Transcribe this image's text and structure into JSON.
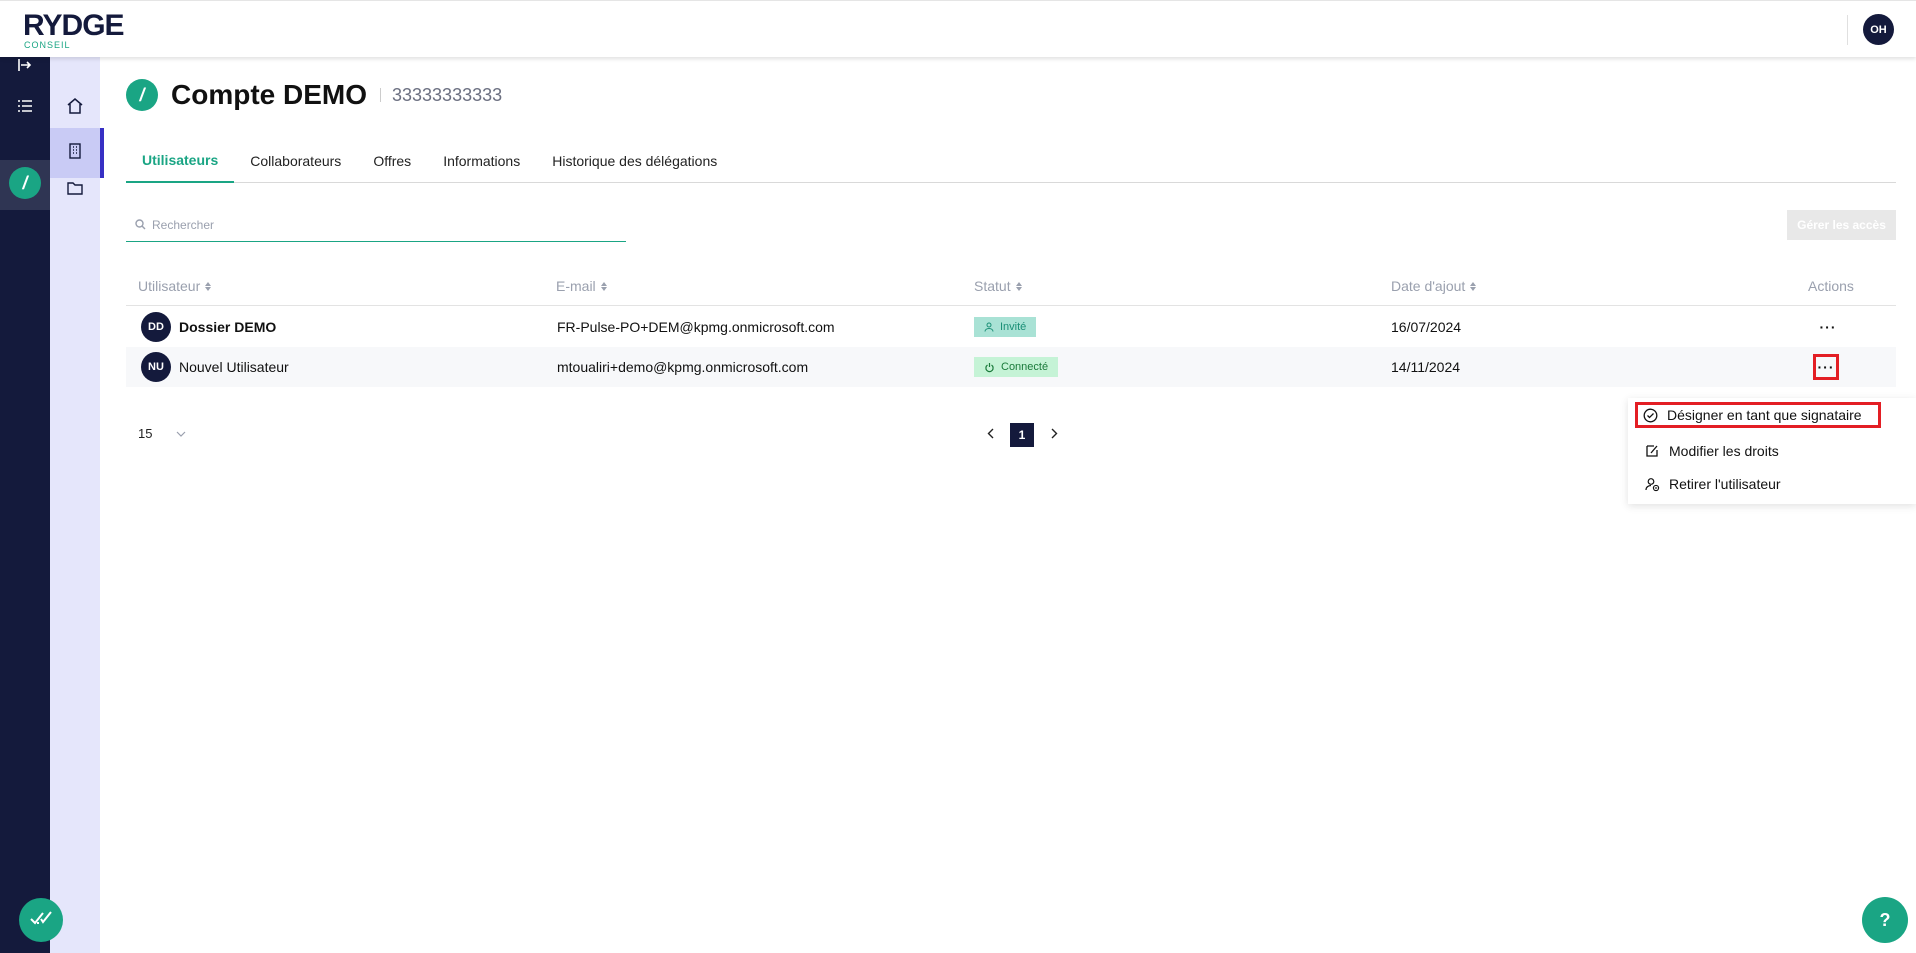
{
  "header": {
    "logo_text": "RYDGE",
    "logo_subtext": "CONSEIL",
    "user_initials": "OH"
  },
  "account": {
    "title": "Compte DEMO",
    "id_number": "33333333333"
  },
  "tabs": [
    {
      "label": "Utilisateurs",
      "active": true
    },
    {
      "label": "Collaborateurs",
      "active": false
    },
    {
      "label": "Offres",
      "active": false
    },
    {
      "label": "Informations",
      "active": false
    },
    {
      "label": "Historique des délégations",
      "active": false
    }
  ],
  "search": {
    "placeholder": "Rechercher"
  },
  "toolbar": {
    "manage_access_label": "Gérer les accès"
  },
  "table": {
    "columns": [
      "Utilisateur",
      "E-mail",
      "Statut",
      "Date d'ajout",
      "Actions"
    ],
    "rows": [
      {
        "initials": "DD",
        "name": "Dossier DEMO",
        "email": "FR-Pulse-PO+DEM@kpmg.onmicrosoft.com",
        "status": "Invité",
        "date": "16/07/2024",
        "actions": "···"
      },
      {
        "initials": "NU",
        "name": "Nouvel Utilisateur",
        "email": "mtoualiri+demo@kpmg.onmicrosoft.com",
        "status": "Connecté",
        "date": "14/11/2024",
        "actions": "···"
      }
    ]
  },
  "pagination": {
    "page_size": "15",
    "current_page": "1"
  },
  "context_menu": {
    "items": [
      {
        "label": "Désigner en tant que signataire",
        "icon": "check-circle-icon"
      },
      {
        "label": "Modifier les droits",
        "icon": "edit-icon"
      },
      {
        "label": "Retirer l'utilisateur",
        "icon": "remove-user-icon"
      }
    ]
  },
  "help": {
    "label": "?"
  },
  "colors": {
    "brand_navy": "#141a3c",
    "brand_green": "#1aa584",
    "highlight_red": "#e31e24",
    "sidenav_bg": "#e5e6fb"
  }
}
